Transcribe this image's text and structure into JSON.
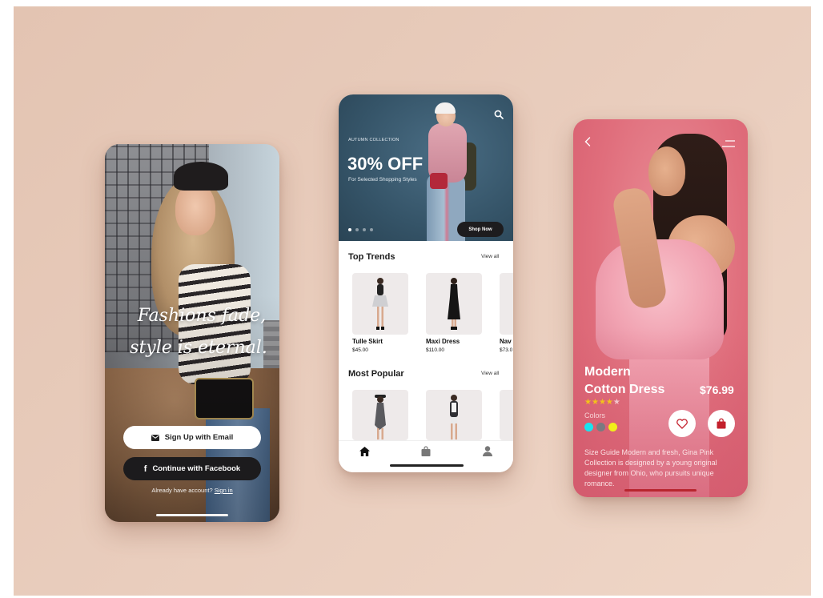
{
  "screens": {
    "welcome": {
      "tagline_line1": "Fashions fade,",
      "tagline_line2": "style is eternal.",
      "email_button": "Sign Up with Email",
      "facebook_button": "Continue with Facebook",
      "account_prompt": "Already have account?",
      "signin_link": "Sign in"
    },
    "shop": {
      "hero": {
        "eyebrow": "AUTUMN COLLECTION",
        "headline": "30% OFF",
        "subline": "For Selected Shopping Styles",
        "cta": "Shop Now",
        "slides_total": 4,
        "active_slide": 1
      },
      "top_trends": {
        "title": "Top Trends",
        "view_all": "View all",
        "items": [
          {
            "name": "Tulle Skirt",
            "price": "$45.00"
          },
          {
            "name": "Maxi Dress",
            "price": "$110.00"
          },
          {
            "name": "Nav",
            "price": "$73.0"
          }
        ]
      },
      "most_popular": {
        "title": "Most Popular",
        "view_all": "View all"
      },
      "tabbar_icons": [
        "home-icon",
        "shopping-bag-icon",
        "user-icon"
      ]
    },
    "product": {
      "title_line1": "Modern",
      "title_line2": "Cotton Dress",
      "price": "$76.99",
      "rating": 4,
      "rating_max": 5,
      "colors_label": "Colors",
      "colors": [
        "#19e3ee",
        "#7a7a80",
        "#f1ef1a"
      ],
      "description": "Size Guide Modern and fresh, Gina Pink Collection is designed by a young original designer from Ohio, who pursuits unique romance."
    }
  },
  "theme": {
    "background": "#e8ccbc",
    "accent_dark": "#1d1c1e",
    "product_pink": "#e06e7c",
    "star_color": "#f3c21a",
    "bag_red": "#c3202c"
  }
}
